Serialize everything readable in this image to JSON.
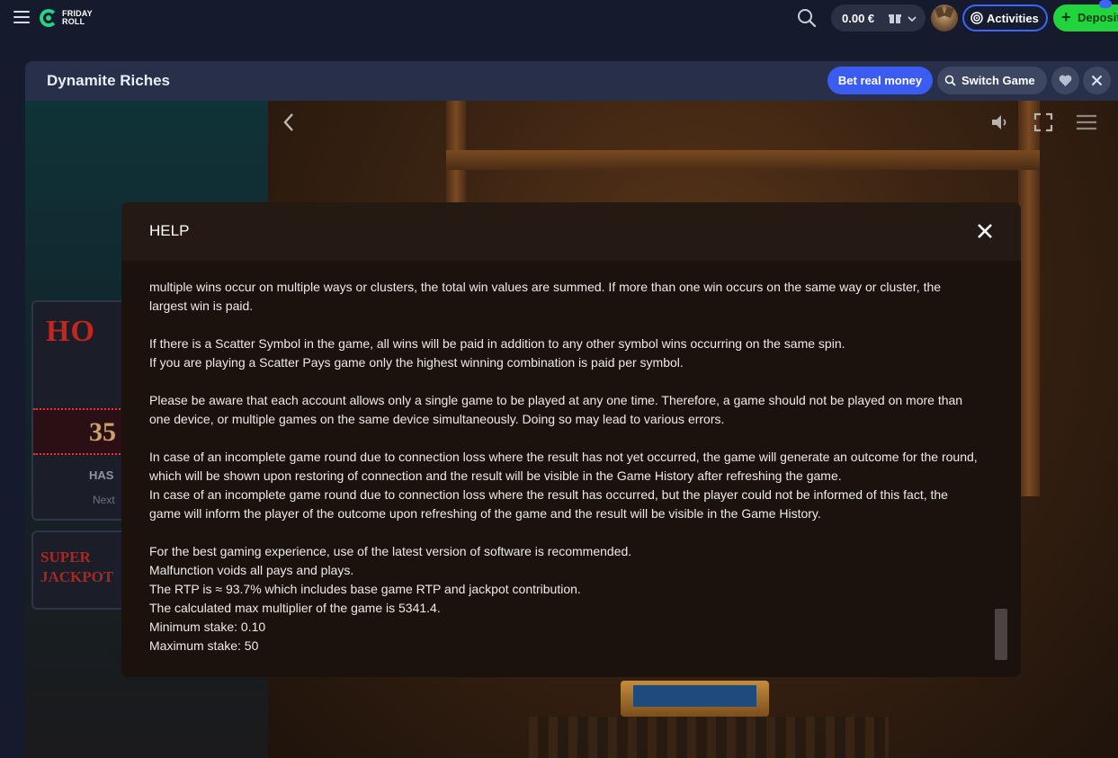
{
  "header": {
    "logo_line1": "FRIDAY",
    "logo_line2": "ROLL",
    "balance": "0.00 €",
    "activities_label": "Activities",
    "deposit_label": "Deposit",
    "badge_text": "🇪"
  },
  "frame": {
    "title": "Dynamite Riches",
    "bet_real_label": "Bet real money",
    "switch_label": "Switch Game"
  },
  "game": {
    "sign_hot": "HO",
    "sign_number": "35",
    "sign_has": "HAS",
    "sign_next": "Next",
    "super_line1": "SUPER",
    "super_line2": "JACKPOT"
  },
  "modal": {
    "title": "HELP",
    "paragraphs": [
      [
        "multiple wins occur on multiple ways or clusters, the total win values are summed. If more than one win occurs on the same way or cluster, the",
        "largest win is paid."
      ],
      [
        "If there is a Scatter Symbol in the game, all wins will be paid in addition to any other symbol wins occurring on the same spin.",
        "If you are playing a Scatter Pays game only the highest winning combination is paid per symbol."
      ],
      [
        "Please be aware that each account allows only a single game to be played at any one time. Therefore, a game should not be played on more than",
        "one device, or multiple games on the same device simultaneously. Doing so may lead to various errors."
      ],
      [
        "In case of an incomplete game round due to connection loss where the result has not yet occurred, the game will generate an outcome for the round,",
        "which will be shown upon restoring of connection and the result will be visible in the Game History after refreshing the game.",
        "In case of an incomplete game round due to connection loss where the result has occurred, but the player could not be informed of this fact, the",
        "game will inform the player of the outcome upon refreshing of the game and the result will be visible in the Game History."
      ],
      [
        "For the best gaming experience, use of the latest version of software is recommended.",
        "Malfunction voids all pays and plays.",
        "The RTP is ≈ 93.7% which includes base game RTP and jackpot contribution.",
        "The calculated max multiplier of the game is 5341.4.",
        "Minimum stake: 0.10",
        "Maximum stake: 50"
      ]
    ]
  },
  "colors": {
    "accent_blue": "#3b5cf0",
    "deposit_green": "#21d33d",
    "brand_green": "#28d18a"
  }
}
